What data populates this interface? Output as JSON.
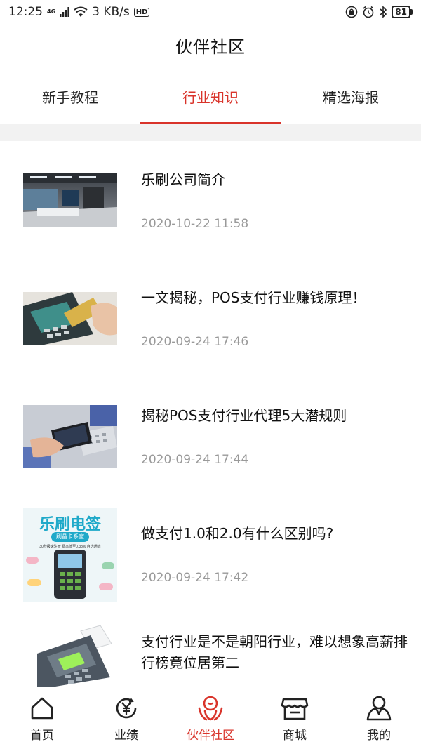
{
  "status_bar": {
    "time": "12:25",
    "network": "4G",
    "speed": "3 KB/s",
    "hd": "HD",
    "battery": "81"
  },
  "header": {
    "title": "伙伴社区"
  },
  "tabs": [
    {
      "label": "新手教程",
      "active": false
    },
    {
      "label": "行业知识",
      "active": true
    },
    {
      "label": "精选海报",
      "active": false
    }
  ],
  "articles": [
    {
      "title": "乐刷公司简介",
      "date": "2020-10-22 11:58",
      "thumb": "office-photo"
    },
    {
      "title": "一文揭秘，POS支付行业赚钱原理！",
      "date": "2020-09-24 17:46",
      "thumb": "card-terminal-photo"
    },
    {
      "title": "揭秘POS支付行业代理5大潜规则",
      "date": "2020-09-24 17:44",
      "thumb": "phone-payment-photo"
    },
    {
      "title": "做支付1.0和2.0有什么区别吗?",
      "date": "2020-09-24 17:42",
      "thumb": "poster-image",
      "poster": {
        "headline": "乐刷电签",
        "badge": "刷晶卡系室",
        "small": "30秒极速注册 费率低至0.38% 自选通道"
      }
    },
    {
      "title": "支付行业是不是朝阳行业，难以想象高薪排行榜竟位居第二",
      "date": "",
      "thumb": "pos-machine-photo"
    }
  ],
  "bottom_nav": [
    {
      "label": "首页",
      "icon": "home-icon",
      "active": false
    },
    {
      "label": "业绩",
      "icon": "yen-icon",
      "active": false
    },
    {
      "label": "伙伴社区",
      "icon": "community-icon",
      "active": true
    },
    {
      "label": "商城",
      "icon": "shop-icon",
      "active": false
    },
    {
      "label": "我的",
      "icon": "user-icon",
      "active": false
    }
  ],
  "colors": {
    "accent": "#d9342b",
    "text": "#222222",
    "muted": "#999999",
    "band": "#f2f2f2"
  }
}
